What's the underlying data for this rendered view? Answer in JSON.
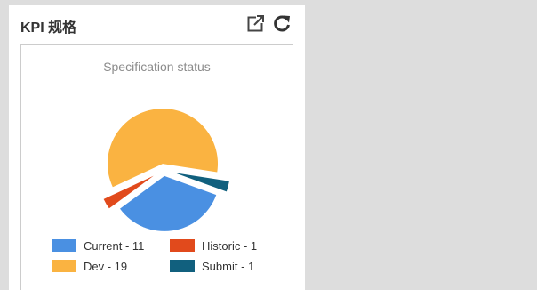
{
  "widget": {
    "title": "KPI 规格",
    "icons": {
      "open_external": "external-link-icon",
      "refresh": "refresh-icon"
    }
  },
  "chart_data": {
    "type": "pie",
    "title": "Specification status",
    "slices": [
      {
        "label": "Current",
        "value": 11,
        "color": "#4a90e2",
        "legend": "Current - 11"
      },
      {
        "label": "Historic",
        "value": 1,
        "color": "#e14a1c",
        "legend": "Historic - 1"
      },
      {
        "label": "Dev",
        "value": 19,
        "color": "#fab341",
        "legend": "Dev - 19"
      },
      {
        "label": "Submit",
        "value": 1,
        "color": "#11607e",
        "legend": "Submit - 1"
      }
    ],
    "legend_position": "bottom"
  }
}
